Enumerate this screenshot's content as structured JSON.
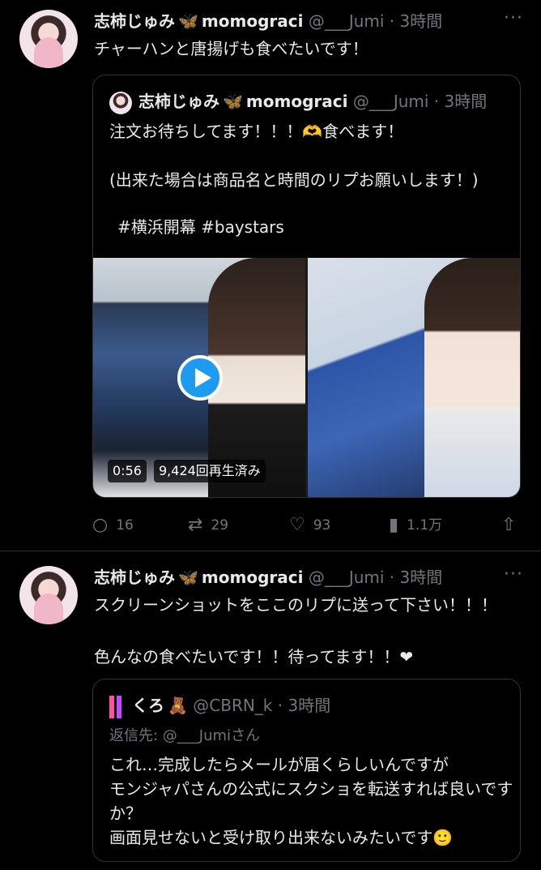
{
  "tweet1": {
    "name": "志柿じゅみ",
    "butterfly": "🦋",
    "name2": "momograci",
    "handle": "@___Jumi",
    "time": "· 3時間",
    "more": "···",
    "text": "チャーハンと唐揚げも食べたいです！",
    "quote": {
      "name": "志柿じゅみ",
      "butterfly": "🦋",
      "name2": "momograci",
      "handle": "@___Jumi",
      "time": "· 3時間",
      "line1": "注文お待ちしてます！！！🫶食べます！",
      "line2": "(出来た場合は商品名と時間のリプお願いします！)",
      "hashtags": "#横浜開幕  #baystars",
      "video_duration": "0:56",
      "video_views": "9,424回再生済み"
    },
    "actions": {
      "reply_count": "16",
      "retweet_count": "29",
      "like_count": "93",
      "view_count": "1.1万"
    }
  },
  "tweet2": {
    "name": "志柿じゅみ",
    "butterfly": "🦋",
    "name2": "momograci",
    "handle": "@___Jumi",
    "time": "· 3時間",
    "more": "···",
    "text": "スクリーンショットをここのリプに送って下さい！！！\n\n色んなの食べたいです！！待ってます！！❤",
    "quote": {
      "name": "くろ",
      "bear": "🧸",
      "handle": "@CBRN_k",
      "time": "· 3時間",
      "reply_to_label": "返信先: ",
      "reply_to_user": "@___Jumiさん",
      "body": "これ…完成したらメールが届くらしいんですが\nモンジャパさんの公式にスクショを転送すれば良いですか？\n画面見せないと受け取り出来ないみたいです🙂"
    }
  },
  "icons": {
    "reply": "speech-bubble-icon",
    "retweet": "retweet-icon",
    "like": "heart-icon",
    "views": "bar-chart-icon",
    "share": "share-icon"
  }
}
